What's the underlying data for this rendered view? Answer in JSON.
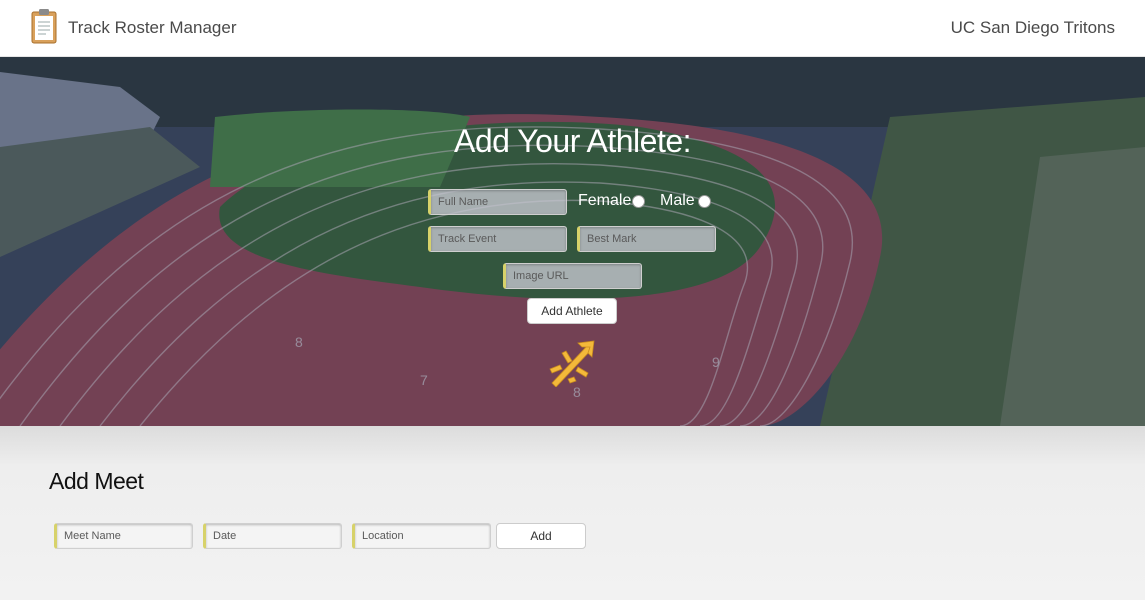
{
  "navbar": {
    "app_title": "Track Roster Manager",
    "team_name": "UC San Diego Tritons"
  },
  "athlete_form": {
    "title": "Add Your Athlete:",
    "full_name_placeholder": "Full Name",
    "gender_female_label": "Female",
    "gender_male_label": "Male",
    "track_event_placeholder": "Track Event",
    "best_mark_placeholder": "Best Mark",
    "image_url_placeholder": "Image URL",
    "submit_label": "Add Athlete"
  },
  "meet_form": {
    "title": "Add Meet",
    "meet_name_placeholder": "Meet Name",
    "date_placeholder": "Date",
    "location_placeholder": "Location",
    "submit_label": "Add"
  },
  "icons": {
    "clipboard": "clipboard-icon",
    "trident": "trident-logo"
  },
  "colors": {
    "input_accent": "#d7d26a",
    "trident_gold": "#f3b93a",
    "track_red": "#9c4b57",
    "field_green": "#4f8a44"
  }
}
